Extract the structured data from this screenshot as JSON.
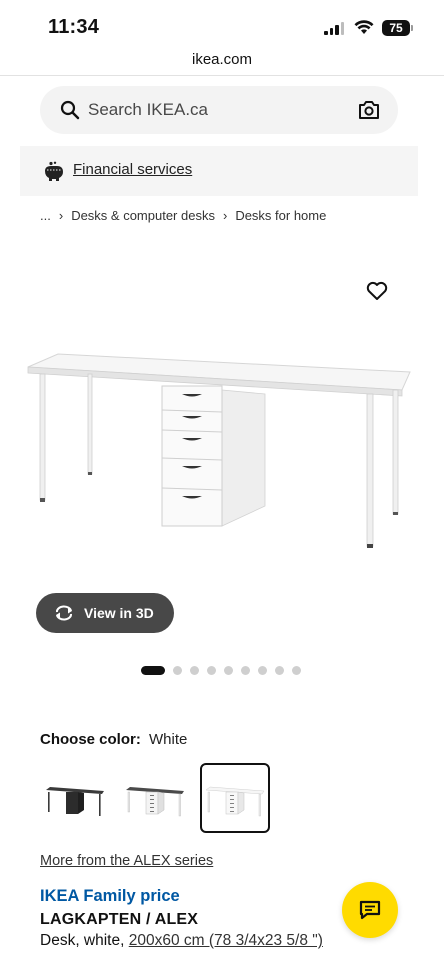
{
  "status_bar": {
    "time": "11:34",
    "battery": "75"
  },
  "browser": {
    "url": "ikea.com"
  },
  "search": {
    "placeholder": "Search IKEA.ca",
    "search_icon": "search-icon",
    "camera_icon": "camera-icon"
  },
  "financial_banner": {
    "label": "Financial services",
    "icon": "piggy-bank-icon"
  },
  "breadcrumb": {
    "items": [
      "...",
      "Desks & computer desks",
      "Desks for home"
    ],
    "separator": "›"
  },
  "product_gallery": {
    "favourite_icon": "heart-icon",
    "view_3d_label": "View in 3D",
    "view_3d_icon": "rotate-3d-icon",
    "total_images": 9,
    "active_index": 0
  },
  "color_selection": {
    "label": "Choose color:",
    "selected": "White",
    "options": [
      {
        "name": "black-brown",
        "top_color": "#3a3a3a",
        "cabinet_color": "#2c2c2c",
        "legs_color": "#3a3a3a"
      },
      {
        "name": "black-brown/white",
        "top_color": "#4a4a4a",
        "cabinet_color": "#f2f2f2",
        "legs_color": "#f0f0f0"
      },
      {
        "name": "white",
        "top_color": "#f4f4f4",
        "cabinet_color": "#f4f4f4",
        "legs_color": "#e8e8e8"
      }
    ],
    "selected_index": 2
  },
  "series_link": "More from the ALEX series",
  "product": {
    "price_label": "IKEA Family price",
    "name": "LAGKAPTEN / ALEX",
    "desc_prefix": "Desk, white, ",
    "dimensions": "200x60 cm (78 3/4x23 5/8 \")"
  },
  "chat": {
    "icon": "chat-bubble-icon"
  },
  "colors": {
    "accent_blue": "#0058a3",
    "chat_yellow": "#ffdb00",
    "pill_dark": "#484848"
  }
}
